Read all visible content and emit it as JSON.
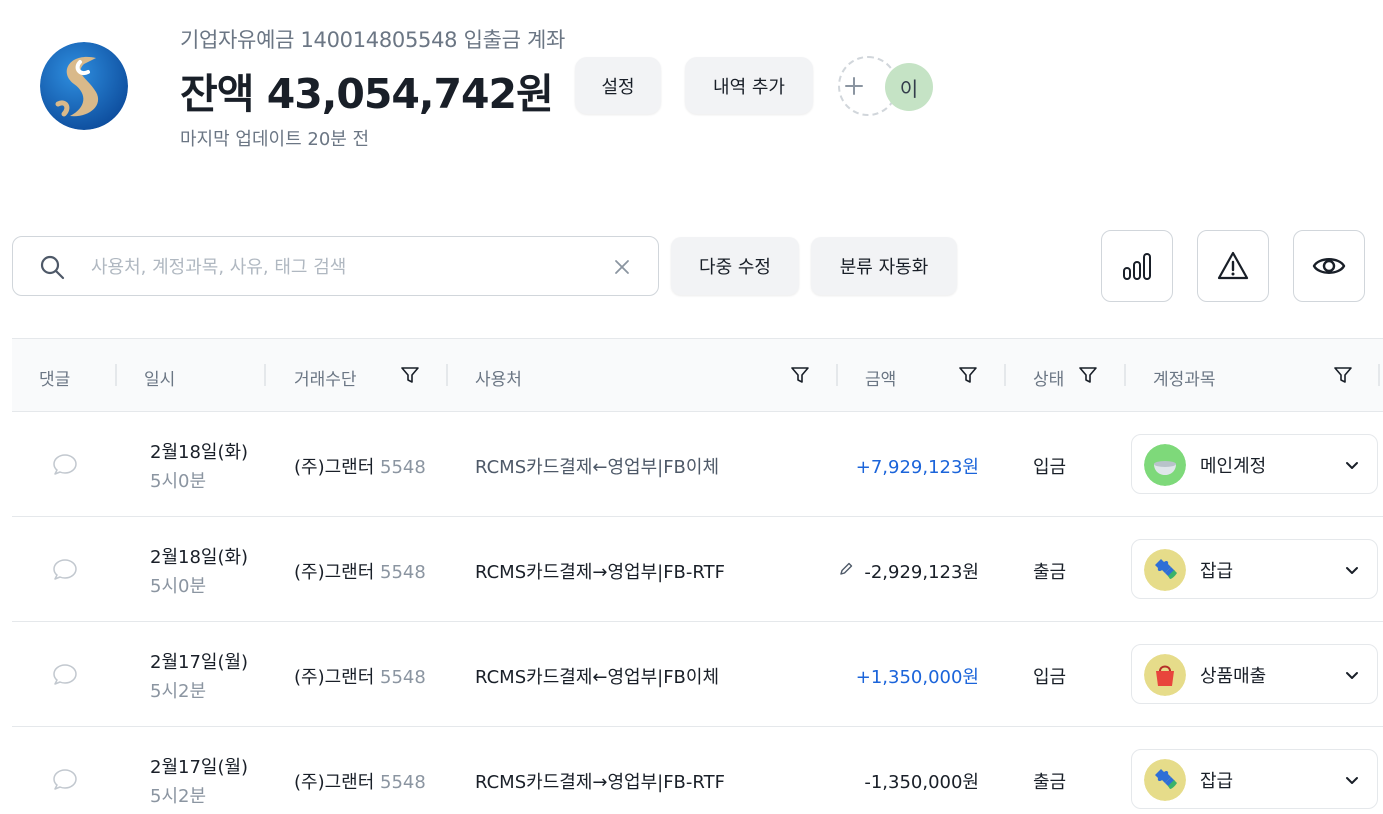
{
  "header": {
    "account_name": "기업자유예금 140014805548 입출금 계좌",
    "balance": "잔액 43,054,742원",
    "updated": "마지막 업데이트 20분 전",
    "settings_label": "설정",
    "add_history_label": "내역 추가",
    "member_initial": "이"
  },
  "toolbar": {
    "search_placeholder": "사용처, 계정과목, 사유, 태그 검색",
    "multi_edit_label": "다중 수정",
    "auto_classify_label": "분류 자동화"
  },
  "table": {
    "headers": {
      "comment": "댓글",
      "datetime": "일시",
      "method": "거래수단",
      "merchant": "사용처",
      "amount": "금액",
      "status": "상태",
      "account": "계정과목"
    },
    "rows": [
      {
        "date": "2월18일(화)",
        "time": "5시0분",
        "method": "(주)그랜터",
        "method_num": "5548",
        "merchant": "RCMS카드결제←영업부|FB이체",
        "amount": "+7,929,123원",
        "direction": "in",
        "status": "입금",
        "account": "메인계정",
        "account_icon": "bowl-icon",
        "edited": false
      },
      {
        "date": "2월18일(화)",
        "time": "5시0분",
        "method": "(주)그랜터",
        "method_num": "5548",
        "merchant": "RCMS카드결제→영업부|FB-RTF",
        "amount": "-2,929,123원",
        "direction": "out",
        "status": "출금",
        "account": "잡급",
        "account_icon": "puzzle-icon",
        "edited": true
      },
      {
        "date": "2월17일(월)",
        "time": "5시2분",
        "method": "(주)그랜터",
        "method_num": "5548",
        "merchant": "RCMS카드결제←영업부|FB이체",
        "amount": "+1,350,000원",
        "direction": "in",
        "status": "입금",
        "account": "상품매출",
        "account_icon": "shopping-bag-icon",
        "edited": false
      },
      {
        "date": "2월17일(월)",
        "time": "5시2분",
        "method": "(주)그랜터",
        "method_num": "5548",
        "merchant": "RCMS카드결제→영업부|FB-RTF",
        "amount": "-1,350,000원",
        "direction": "out",
        "status": "출금",
        "account": "잡급",
        "account_icon": "puzzle-icon",
        "edited": false
      }
    ]
  },
  "colors": {
    "income": "#1b64da",
    "text": "#191f28",
    "muted": "#8b95a1",
    "button_bg": "#f2f3f5"
  }
}
